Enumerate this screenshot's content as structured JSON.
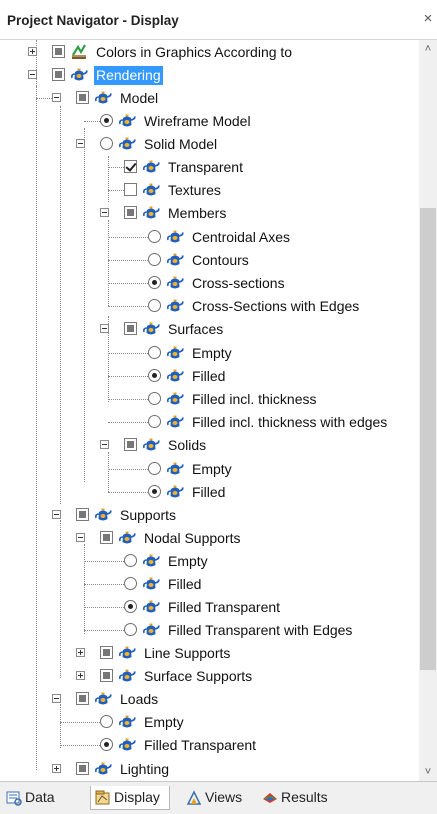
{
  "window": {
    "title": "Project Navigator - Display"
  },
  "tree": {
    "colors_in_graphics": "Colors in Graphics According to",
    "rendering": "Rendering",
    "model": "Model",
    "wireframe_model": "Wireframe Model",
    "solid_model": "Solid Model",
    "transparent": "Transparent",
    "textures": "Textures",
    "members": "Members",
    "centroidal_axes": "Centroidal Axes",
    "contours": "Contours",
    "cross_sections": "Cross-sections",
    "cross_sections_edges": "Cross-Sections with Edges",
    "surfaces": "Surfaces",
    "surf_empty": "Empty",
    "surf_filled": "Filled",
    "surf_filled_thick": "Filled incl. thickness",
    "surf_filled_thick_edges": "Filled incl. thickness with edges",
    "solids": "Solids",
    "solid_empty": "Empty",
    "solid_filled": "Filled",
    "supports": "Supports",
    "nodal_supports": "Nodal Supports",
    "ns_empty": "Empty",
    "ns_filled": "Filled",
    "ns_filled_transparent": "Filled Transparent",
    "ns_filled_transparent_edges": "Filled Transparent with Edges",
    "line_supports": "Line Supports",
    "surface_supports": "Surface Supports",
    "loads": "Loads",
    "loads_empty": "Empty",
    "loads_filled_transparent": "Filled Transparent",
    "lighting": "Lighting"
  },
  "tabs": {
    "data": "Data",
    "display": "Display",
    "views": "Views",
    "results": "Results"
  },
  "colors": {
    "selection": "#3399ff",
    "teapot": "#1f5fbf"
  }
}
